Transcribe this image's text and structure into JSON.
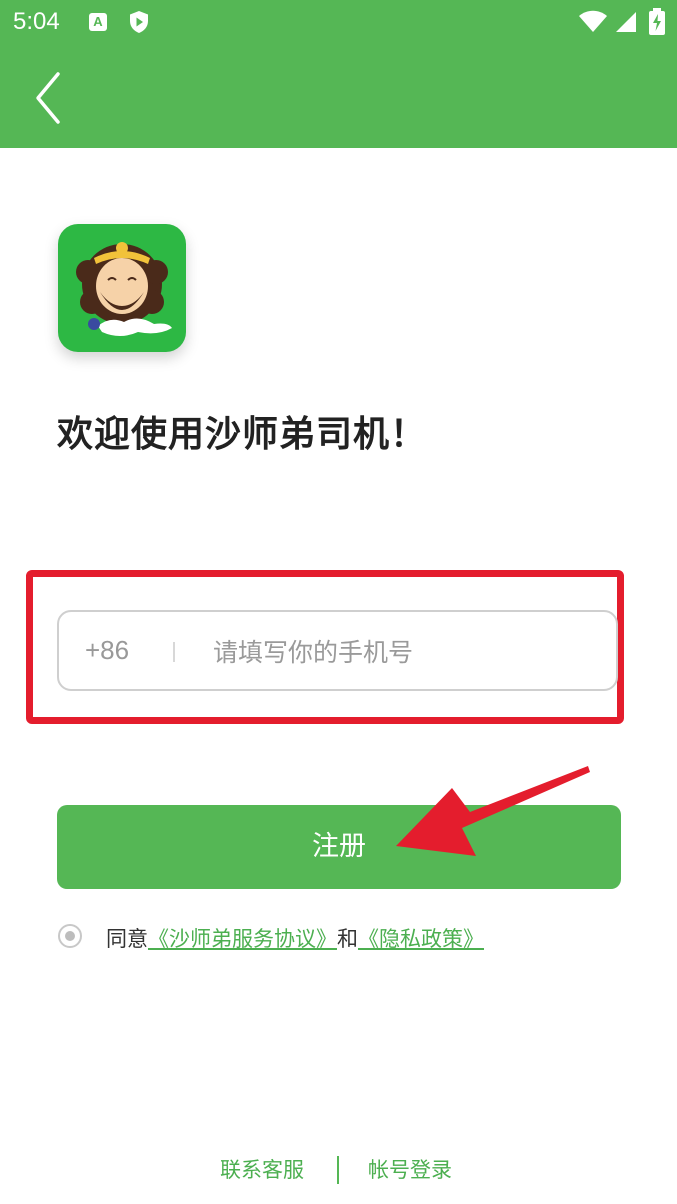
{
  "status_bar": {
    "time": "5:04",
    "a_icon_label": "A"
  },
  "app": {
    "welcome": "欢迎使用沙师弟司机！"
  },
  "phone": {
    "country_code": "+86",
    "placeholder": "请填写你的手机号",
    "value": ""
  },
  "register": {
    "label": "注册"
  },
  "agreement": {
    "prefix": "同意",
    "service_link": "《沙师弟服务协议》",
    "connector": "和",
    "privacy_link": "《隐私政策》"
  },
  "footer": {
    "support": "联系客服",
    "account_login": "帐号登录"
  },
  "colors": {
    "brand_green": "#55b755",
    "highlight_red": "#e41d2d"
  }
}
